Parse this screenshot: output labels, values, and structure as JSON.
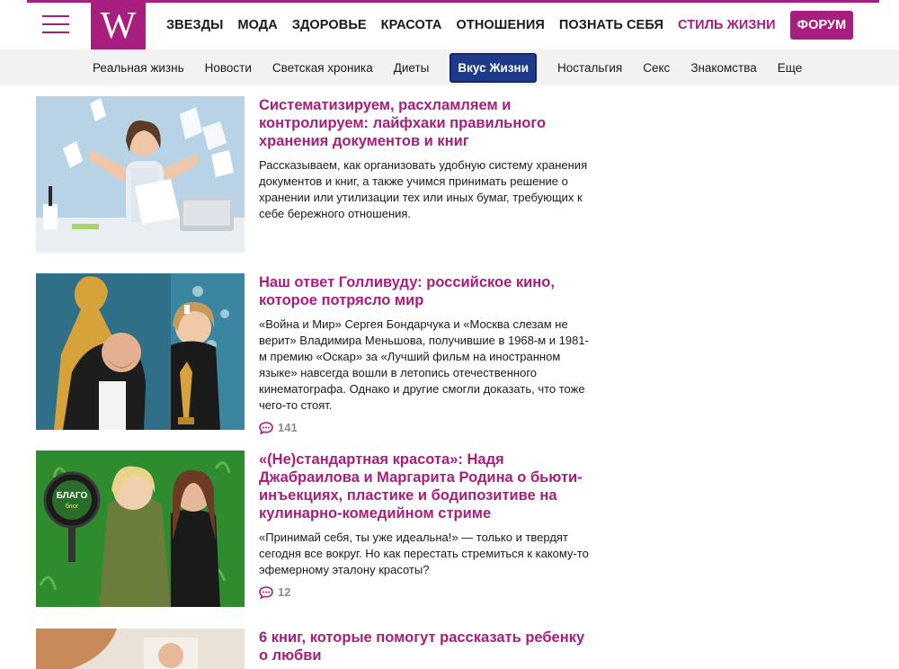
{
  "header": {
    "logo_letter": "W",
    "nav": [
      {
        "label": "ЗВЕЗДЫ"
      },
      {
        "label": "МОДА"
      },
      {
        "label": "ЗДОРОВЬЕ"
      },
      {
        "label": "КРАСОТА"
      },
      {
        "label": "ОТНОШЕНИЯ"
      },
      {
        "label": "ПОЗНАТЬ СЕБЯ"
      },
      {
        "label": "СТИЛЬ ЖИЗНИ"
      },
      {
        "label": "ФОРУМ"
      }
    ]
  },
  "subnav": [
    {
      "label": "Реальная жизнь"
    },
    {
      "label": "Новости"
    },
    {
      "label": "Светская хроника"
    },
    {
      "label": "Диеты"
    },
    {
      "label": "Вкус Жизни"
    },
    {
      "label": "Ностальгия"
    },
    {
      "label": "Секс"
    },
    {
      "label": "Знакомства"
    },
    {
      "label": "Еще"
    }
  ],
  "articles": [
    {
      "title": "Систематизируем, расхламляем и контролируем: лайфхаки правильного хранения документов и книг",
      "excerpt": "Рассказываем, как организовать удобную систему хранения документов и книг, а также учимся принимать решение о хранении или утилизации тех или иных бумаг, требующих к себе бережного отношения."
    },
    {
      "title": "Наш ответ Голливуду: российское кино, которое потрясло мир",
      "excerpt": "«Война и Мир» Сергея Бондарчука и «Москва слезам не верит» Владимира Меньшова, получившие в 1968-м и 1981-м премию «Оскар» за «Лучший фильм на иностранном языке» навсегда вошли в летопись отечественного кинематографа. Однако и другие смогли доказать, что тоже чего-то стоят.",
      "comments": "141"
    },
    {
      "title": "«(Не)стандартная красота»: Надя Джабраилова и Маргарита Родина о бьюти-инъекциях, пластике и бодипозитиве на кулинарно-комедийном стриме",
      "excerpt": "«Принимай себя, ты уже идеальна!» — только и твердят сегодня все вокруг. Но как перестать стремиться к какому-то эфемерному эталону красоты?",
      "comments": "12",
      "badge_line1": "БЛАГО",
      "badge_line2": "блог"
    },
    {
      "title": "6 книг, которые помогут рассказать ребенку о любви"
    }
  ]
}
